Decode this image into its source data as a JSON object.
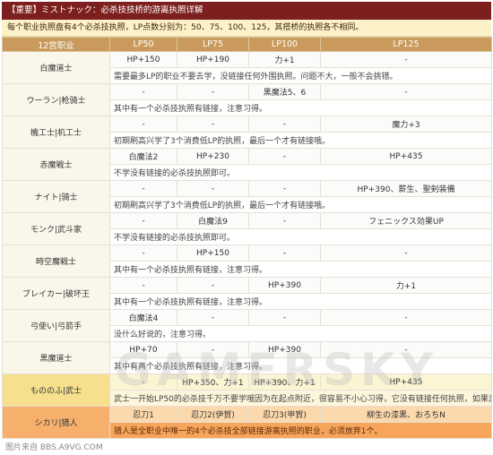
{
  "title": "【重要】ミストナック：必杀技技桥的游离执照详解",
  "subtitle": "每个职业执照盘有4个必杀技执照，LP点数分别为：50、75、100、125，其搭桥的执照各不相同。",
  "columns": [
    "12宫职业",
    "LP50",
    "LP75",
    "LP100",
    "LP125"
  ],
  "rows": [
    {
      "job": "白魔道士",
      "values": [
        "HP+150",
        "HP+190",
        "力+1",
        "-"
      ],
      "note": "需要最多LP的职业不要去学，没链接任何外围执照。问题不大，一般不会挑错。"
    },
    {
      "job": "ウーラン|枪骑士",
      "values": [
        "-",
        "-",
        "黑魔法5、6",
        "-"
      ],
      "note": "其中有一个必杀技执照有链接，注意习得。"
    },
    {
      "job": "機工士|机工士",
      "values": [
        "-",
        "-",
        "-",
        "魔力+3"
      ],
      "note": "初期刷高兴学了3个消费低LP的执照，最后一个才有链接哦。"
    },
    {
      "job": "赤魔戦士",
      "values": [
        "白魔法2",
        "HP+230",
        "-",
        "HP+435"
      ],
      "note": "不学没有链接的必杀技执照即可。"
    },
    {
      "job": "ナイト|骑士",
      "values": [
        "-",
        "-",
        "-",
        "HP+390、薪生、聖剣装備"
      ],
      "note": "初期刷高兴学了3个消费低LP的执照，最后一个才有链接哦。"
    },
    {
      "job": "モンク|武斗家",
      "values": [
        "-",
        "白魔法9",
        "-",
        "フェニックス効果UP"
      ],
      "note": "不学没有链接的必杀技执照即可。"
    },
    {
      "job": "時空魔戦士",
      "values": [
        "-",
        "HP+150",
        "-",
        "-"
      ],
      "note": "其中有一个必杀技执照有链接，注意习得。"
    },
    {
      "job": "ブレイカー|破坏王",
      "values": [
        "-",
        "-",
        "HP+390",
        "力+1"
      ],
      "note": "其中有一个必杀技执照有链接，注意习得。"
    },
    {
      "job": "弓使い|弓箭手",
      "values": [
        "白魔法4",
        "-",
        "-",
        "-"
      ],
      "note": "没什么好说的，注意习得。"
    },
    {
      "job": "黒魔道士",
      "values": [
        "HP+70",
        "-",
        "HP+390",
        "-"
      ],
      "note": "其中有两个必杀技执照有链接，注意习得。"
    },
    {
      "job": "もののふ|武士",
      "values": [
        "-",
        "HP+350、力+1",
        "HP+390、力+1",
        "HP+435"
      ],
      "note": "武士一开始LP50的必杀技千万不要学哦因为在起点附近，很容易不小心习得，它没有链接任何执照，如果激活了LP50的必杀技执照则将学不满其他能力了。"
    },
    {
      "job": "シカリ|猎人",
      "values": [
        "忍刀1",
        "忍刀2(伊賀)",
        "忍刀3(甲賀)",
        "柳生の漆黑、おろちN"
      ],
      "note": "猎人是全职业中唯一的4个必杀技全部链接游离执照的职业，必须放弃1个。"
    }
  ],
  "watermark": "GAMERSKY",
  "footer": "图片来自 BBS.A9VG.COM"
}
